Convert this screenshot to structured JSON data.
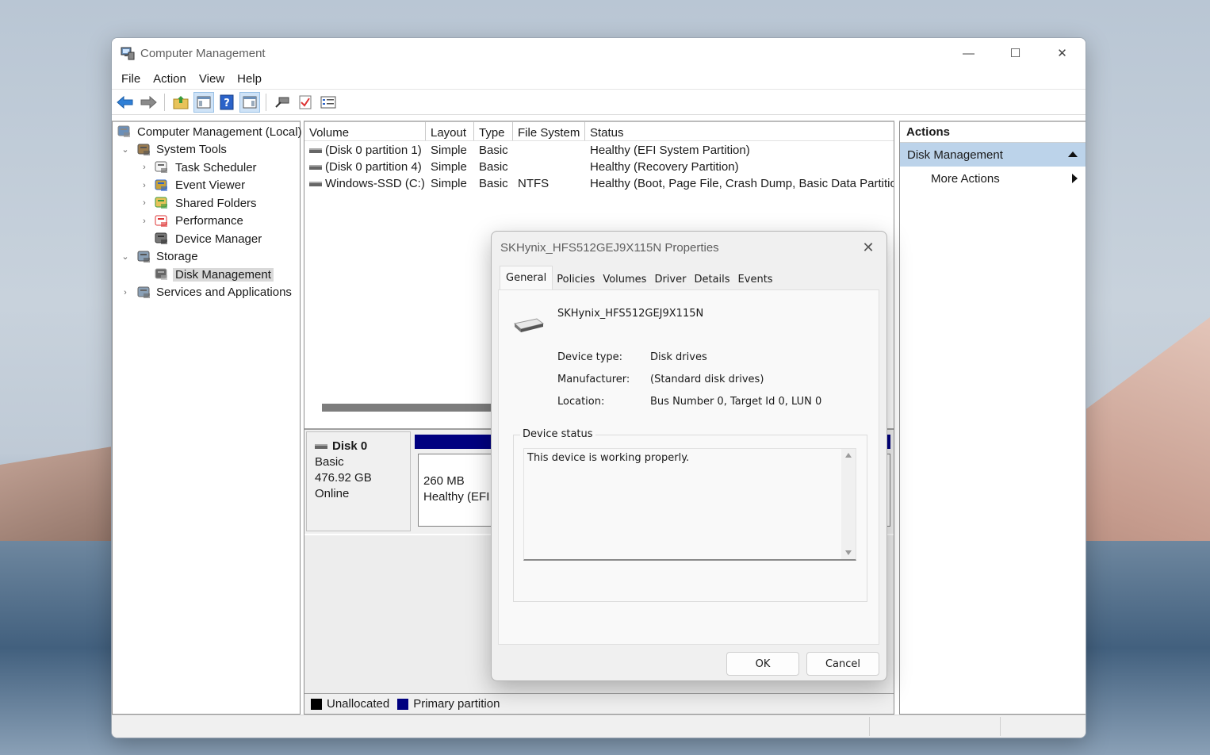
{
  "window": {
    "title": "Computer Management",
    "controls": {
      "minimize": "—",
      "maximize": "☐",
      "close": "✕"
    }
  },
  "menu": [
    "File",
    "Action",
    "View",
    "Help"
  ],
  "toolbar": {
    "icons": [
      "back-arrow-icon",
      "forward-arrow-icon",
      "up-folder-icon",
      "show-hide-tree-icon",
      "help-icon",
      "show-hide-action-pane-icon",
      "connect-icon",
      "check-icon",
      "properties-icon"
    ]
  },
  "tree": [
    {
      "label": "Computer Management (Local)",
      "level": 0,
      "expander": "",
      "icon": "computer-management-icon"
    },
    {
      "label": "System Tools",
      "level": 1,
      "expander": "⌄",
      "icon": "tools-icon"
    },
    {
      "label": "Task Scheduler",
      "level": 2,
      "expander": "›",
      "icon": "clock-icon"
    },
    {
      "label": "Event Viewer",
      "level": 2,
      "expander": "›",
      "icon": "event-viewer-icon"
    },
    {
      "label": "Shared Folders",
      "level": 2,
      "expander": "›",
      "icon": "shared-folder-icon"
    },
    {
      "label": "Performance",
      "level": 2,
      "expander": "›",
      "icon": "performance-icon"
    },
    {
      "label": "Device Manager",
      "level": 2,
      "expander": "",
      "icon": "device-manager-icon"
    },
    {
      "label": "Storage",
      "level": 1,
      "expander": "⌄",
      "icon": "storage-icon"
    },
    {
      "label": "Disk Management",
      "level": 2,
      "expander": "",
      "icon": "disk-icon",
      "selected": true
    },
    {
      "label": "Services and Applications",
      "level": 1,
      "expander": "›",
      "icon": "services-icon"
    }
  ],
  "volumes": {
    "headers": [
      "Volume",
      "Layout",
      "Type",
      "File System",
      "Status"
    ],
    "rows": [
      [
        "(Disk 0 partition 1)",
        "Simple",
        "Basic",
        "",
        "Healthy (EFI System Partition)"
      ],
      [
        "(Disk 0 partition 4)",
        "Simple",
        "Basic",
        "",
        "Healthy (Recovery Partition)"
      ],
      [
        "Windows-SSD (C:)",
        "Simple",
        "Basic",
        "NTFS",
        "Healthy (Boot, Page File, Crash Dump, Basic Data Partition)"
      ]
    ]
  },
  "disk": {
    "name": "Disk 0",
    "type": "Basic",
    "size": "476.92 GB",
    "state": "Online",
    "partition_size": "260 MB",
    "partition_status": "Healthy (EFI S"
  },
  "legend": [
    {
      "label": "Unallocated",
      "color": "#000000"
    },
    {
      "label": "Primary partition",
      "color": "#000080"
    }
  ],
  "actions": {
    "header": "Actions",
    "section": "Disk Management",
    "item": "More Actions"
  },
  "dialog": {
    "title": "SKHynix_HFS512GEJ9X115N Properties",
    "tabs": [
      "General",
      "Policies",
      "Volumes",
      "Driver",
      "Details",
      "Events"
    ],
    "device_name": "SKHynix_HFS512GEJ9X115N",
    "props": [
      {
        "label": "Device type:",
        "value": "Disk drives"
      },
      {
        "label": "Manufacturer:",
        "value": "(Standard disk drives)"
      },
      {
        "label": "Location:",
        "value": "Bus Number 0, Target Id 0, LUN 0"
      }
    ],
    "status_group": "Device status",
    "status_text": "This device is working properly.",
    "ok": "OK",
    "cancel": "Cancel"
  },
  "colors": {
    "primary_partition": "#000080",
    "selection": "#bcd3ea"
  }
}
